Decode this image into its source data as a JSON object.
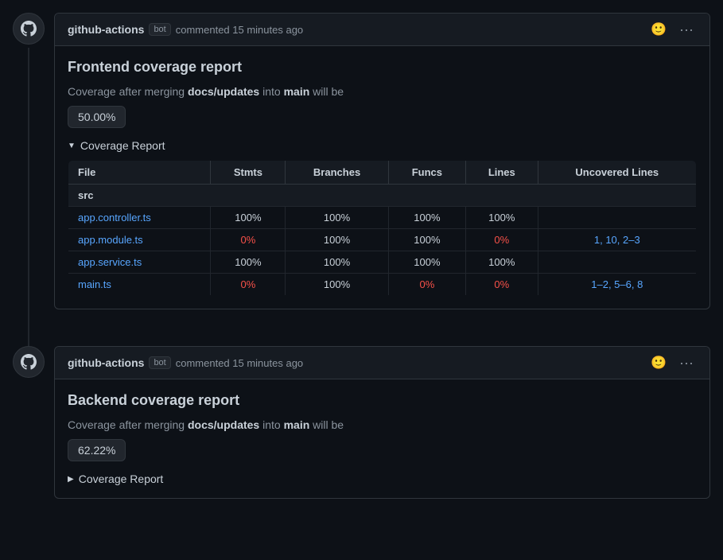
{
  "colors": {
    "accent": "#58a6ff",
    "zero": "#f85149",
    "bg": "#0d1117",
    "surface": "#161b22",
    "border": "#30363d"
  },
  "comments": [
    {
      "id": "comment-1",
      "username": "github-actions",
      "badge": "bot",
      "meta": "commented 15 minutes ago",
      "report_title": "Frontend coverage report",
      "coverage_label": "Coverage after merging",
      "docs_updates": "docs/updates",
      "into": "into",
      "main": "main",
      "will_be": "will be",
      "coverage_value": "50.00%",
      "details_label": "Coverage Report",
      "details_open": true,
      "table": {
        "headers": [
          "File",
          "Stmts",
          "Branches",
          "Funcs",
          "Lines",
          "Uncovered Lines"
        ],
        "src_label": "src",
        "rows": [
          {
            "file": "app.controller.ts",
            "stmts": "100%",
            "branches": "100%",
            "funcs": "100%",
            "lines": "100%",
            "uncovered": "",
            "stmts_zero": false,
            "funcs_zero": false,
            "lines_zero": false
          },
          {
            "file": "app.module.ts",
            "stmts": "0%",
            "branches": "100%",
            "funcs": "100%",
            "lines": "0%",
            "uncovered": "1, 10, 2–3",
            "uncovered_links": [
              "1",
              "10",
              "2–3"
            ],
            "stmts_zero": true,
            "funcs_zero": false,
            "lines_zero": true
          },
          {
            "file": "app.service.ts",
            "stmts": "100%",
            "branches": "100%",
            "funcs": "100%",
            "lines": "100%",
            "uncovered": "",
            "stmts_zero": false,
            "funcs_zero": false,
            "lines_zero": false
          },
          {
            "file": "main.ts",
            "stmts": "0%",
            "branches": "100%",
            "funcs": "0%",
            "lines": "0%",
            "uncovered": "1–2, 5–6, 8",
            "uncovered_links": [
              "1–2",
              "5–6",
              "8"
            ],
            "stmts_zero": true,
            "funcs_zero": true,
            "lines_zero": true
          }
        ]
      }
    },
    {
      "id": "comment-2",
      "username": "github-actions",
      "badge": "bot",
      "meta": "commented 15 minutes ago",
      "report_title": "Backend coverage report",
      "coverage_label": "Coverage after merging",
      "docs_updates": "docs/updates",
      "into": "into",
      "main": "main",
      "will_be": "will be",
      "coverage_value": "62.22%",
      "details_label": "Coverage Report",
      "details_open": false
    }
  ]
}
